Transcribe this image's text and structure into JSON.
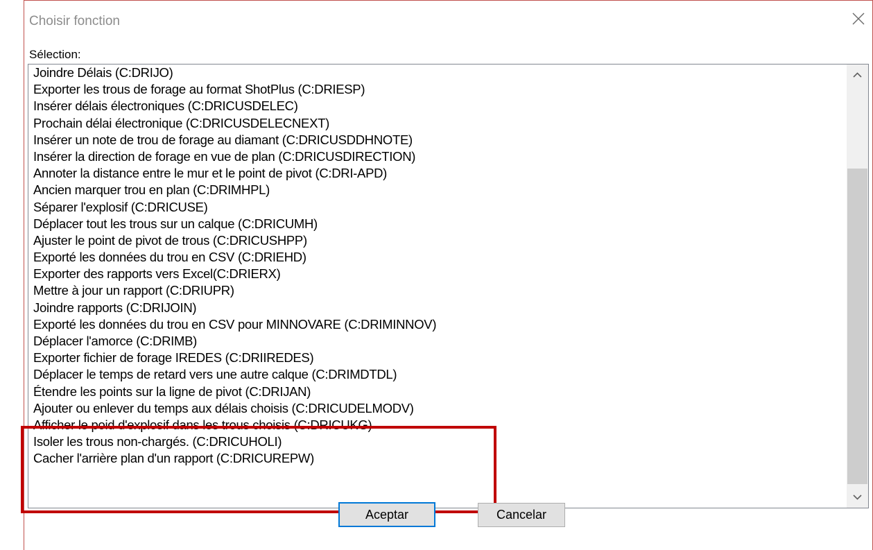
{
  "window": {
    "title": "Choisir fonction",
    "close_icon": "close-icon"
  },
  "selection": {
    "label": "Sélection:",
    "items": [
      "Joindre Délais (C:DRIJO)",
      "Exporter les trous de forage au format ShotPlus (C:DRIESP)",
      "Insérer délais électroniques (C:DRICUSDELEC)",
      "Prochain délai électronique (C:DRICUSDELECNEXT)",
      "Insérer un note de trou de forage au diamant (C:DRICUSDDHNOTE)",
      "Insérer la direction de forage en vue de plan (C:DRICUSDIRECTION)",
      "Annoter la distance entre le mur et le point de pivot (C:DRI-APD)",
      "Ancien marquer trou en plan (C:DRIMHPL)",
      "Séparer l'explosif (C:DRICUSE)",
      "Déplacer tout les trous sur un calque (C:DRICUMH)",
      "Ajuster le point de pivot de trous (C:DRICUSHPP)",
      "Exporté les données du trou en CSV (C:DRIEHD)",
      "Exporter des rapports vers Excel(C:DRIERX)",
      "Mettre à jour un rapport (C:DRIUPR)",
      "Joindre rapports (C:DRIJOIN)",
      "Exporté les données du trou en CSV pour MINNOVARE (C:DRIMINNOV)",
      "Déplacer l'amorce (C:DRIMB)",
      "Exporter fichier de forage IREDES (C:DRIIREDES)",
      "Déplacer le temps de retard vers une autre calque (C:DRIMDTDL)",
      "Étendre les points sur la ligne de pivot (C:DRIJAN)",
      "Ajouter ou enlever du temps aux délais choisis (C:DRICUDELMODV)",
      "Afficher le poid d'explosif dans les trous choisis (C:DRICUKG)",
      "Isoler les trous non-chargés. (C:DRICUHOLI)",
      "Cacher l'arrière plan d'un rapport (C:DRICUREPW)"
    ]
  },
  "buttons": {
    "ok_label": "Aceptar",
    "cancel_label": "Cancelar"
  },
  "scrollbar": {
    "up_icon": "chevron-up-icon",
    "down_icon": "chevron-down-icon"
  },
  "colors": {
    "annotation_box": "#c00000",
    "window_border": "#c0504d",
    "default_button_border": "#0078d7",
    "title_text": "#8c8c8c"
  }
}
